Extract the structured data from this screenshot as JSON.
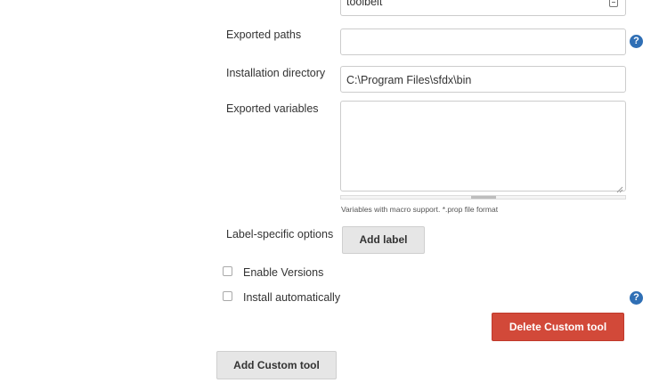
{
  "tool": {
    "name_value": "toolbelt",
    "exported_paths": {
      "label": "Exported paths",
      "value": ""
    },
    "installation_directory": {
      "label": "Installation directory",
      "value": "C:\\Program Files\\sfdx\\bin"
    },
    "exported_variables": {
      "label": "Exported variables",
      "value": "",
      "hint": "Variables with macro support. *.prop file format"
    },
    "label_specific_options": {
      "label": "Label-specific options",
      "add_label_button": "Add label"
    },
    "enable_versions": {
      "label": "Enable Versions",
      "checked": false
    },
    "install_automatically": {
      "label": "Install automatically",
      "checked": false
    },
    "delete_button": "Delete Custom tool"
  },
  "add_custom_tool_button": "Add Custom tool",
  "help_icon_glyph": "?",
  "colors": {
    "help": "#2f6fb5",
    "danger": "#d24939",
    "button_gray": "#e6e6e6"
  }
}
